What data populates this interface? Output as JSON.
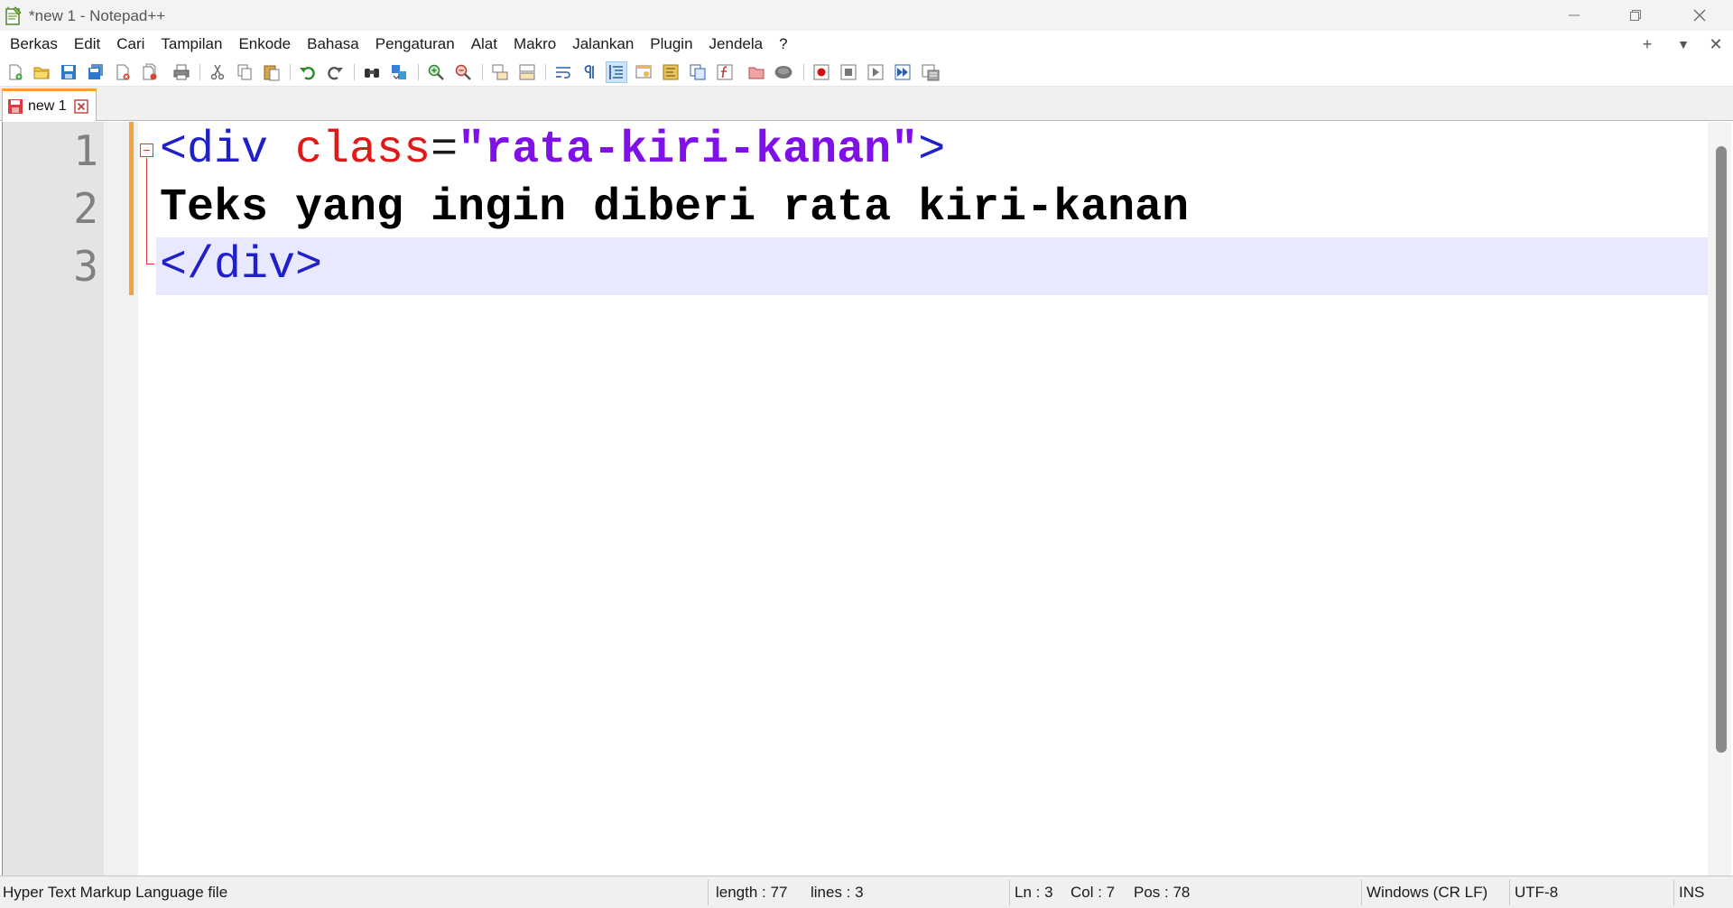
{
  "window": {
    "title": "*new 1 - Notepad++"
  },
  "menu": {
    "items": [
      "Berkas",
      "Edit",
      "Cari",
      "Tampilan",
      "Enkode",
      "Bahasa",
      "Pengaturan",
      "Alat",
      "Makro",
      "Jalankan",
      "Plugin",
      "Jendela",
      "?"
    ],
    "right": {
      "add": "+",
      "dropdown": "▼",
      "close": "✕"
    }
  },
  "tabs": [
    {
      "label": "new 1",
      "modified": true
    }
  ],
  "editor": {
    "line_numbers": [
      "1",
      "2",
      "3"
    ],
    "line1": {
      "open": "<div",
      "space": " ",
      "attr": "class",
      "eq": "=",
      "str": "\"rata-kiri-kanan\"",
      "close": ">"
    },
    "line2": "Teks yang ingin diberi rata kiri-kanan",
    "line3": "</div>",
    "current_line": 3
  },
  "status": {
    "file_type": "Hyper Text Markup Language file",
    "length": "length : 77",
    "lines": "lines : 3",
    "ln": "Ln : 3",
    "col": "Col : 7",
    "pos": "Pos : 78",
    "eol": "Windows (CR LF)",
    "encoding": "UTF-8",
    "mode": "INS"
  },
  "colors": {
    "tag": "#2020c8",
    "attribute": "#e01818",
    "string": "#8010e8",
    "current_line": "#e8e8ff",
    "tab_accent": "#fa9d3c"
  },
  "icons": {
    "app": "notepadpp-icon",
    "toolbar": [
      "new-file-icon",
      "open-file-icon",
      "save-icon",
      "save-all-icon",
      "close-icon",
      "close-all-icon",
      "print-icon",
      "cut-icon",
      "copy-icon",
      "paste-icon",
      "undo-icon",
      "redo-icon",
      "find-icon",
      "replace-icon",
      "zoom-in-icon",
      "zoom-out-icon",
      "sync-vertical-icon",
      "sync-horizontal-icon",
      "word-wrap-icon",
      "show-all-chars-icon",
      "indent-guide-icon",
      "user-language-icon",
      "doc-map-icon",
      "doc-list-icon",
      "function-list-icon",
      "folder-workspace-icon",
      "monitor-icon",
      "record-macro-icon",
      "stop-macro-icon",
      "play-macro-icon",
      "run-macro-multiple-icon",
      "save-macro-icon"
    ]
  }
}
